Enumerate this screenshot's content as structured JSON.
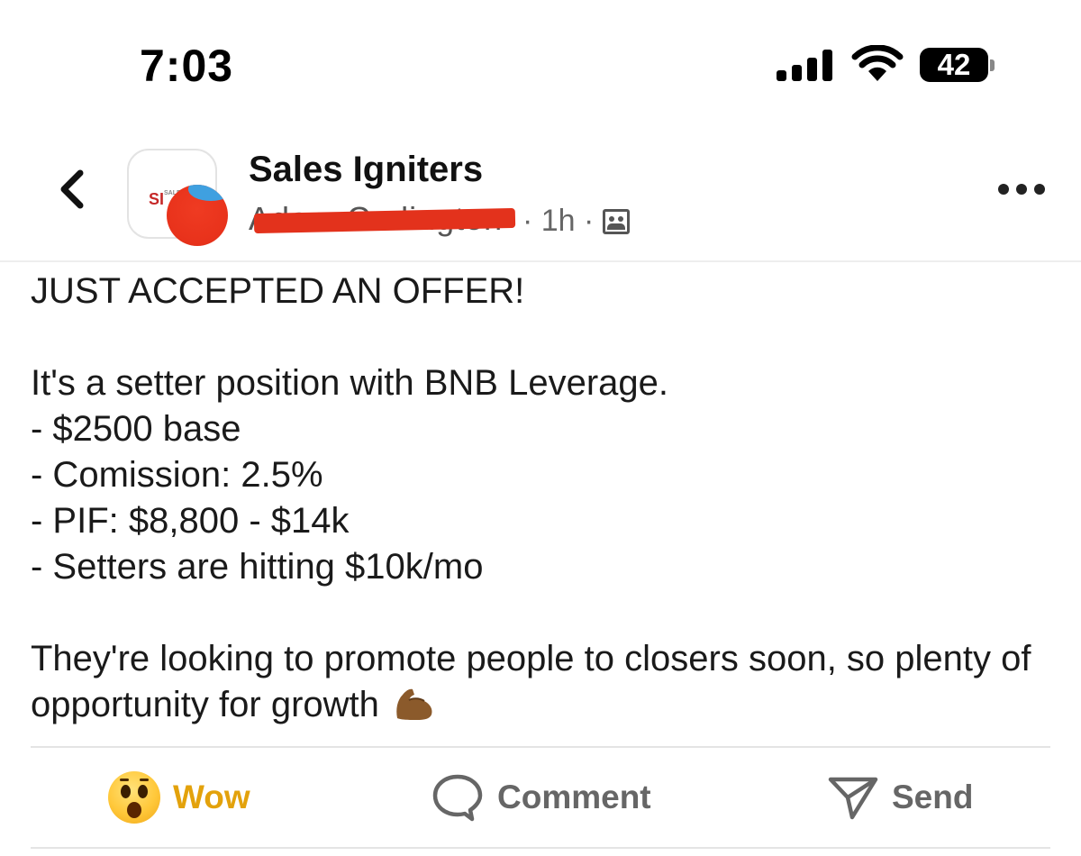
{
  "status_bar": {
    "time": "7:03",
    "battery": "42"
  },
  "header": {
    "group_name": "Sales Igniters",
    "author_name": "Adam Codington",
    "timestamp": "· 1h ·",
    "group_logo_text": "SI",
    "group_logo_subtext": "SALES"
  },
  "post": {
    "headline": "JUST ACCEPTED AN OFFER!",
    "intro": "It's a setter position with BNB Leverage.",
    "bullets": [
      "- $2500 base",
      "- Comission: 2.5%",
      "- PIF: $8,800 - $14k",
      "- Setters are hitting $10k/mo"
    ],
    "closing": "They're looking to promote people to closers soon, so plenty of opportunity for growth"
  },
  "actions": {
    "wow_label": "Wow",
    "comment_label": "Comment",
    "send_label": "Send"
  },
  "colors": {
    "wow": "#e3a20c",
    "redaction": "#e3321c",
    "muted": "#666666"
  },
  "icons": [
    "back-chevron-icon",
    "signal-icon",
    "wifi-icon",
    "battery-icon",
    "group-icon",
    "more-icon",
    "flexed-bicep-emoji",
    "wow-reaction-icon",
    "comment-icon",
    "send-icon"
  ]
}
